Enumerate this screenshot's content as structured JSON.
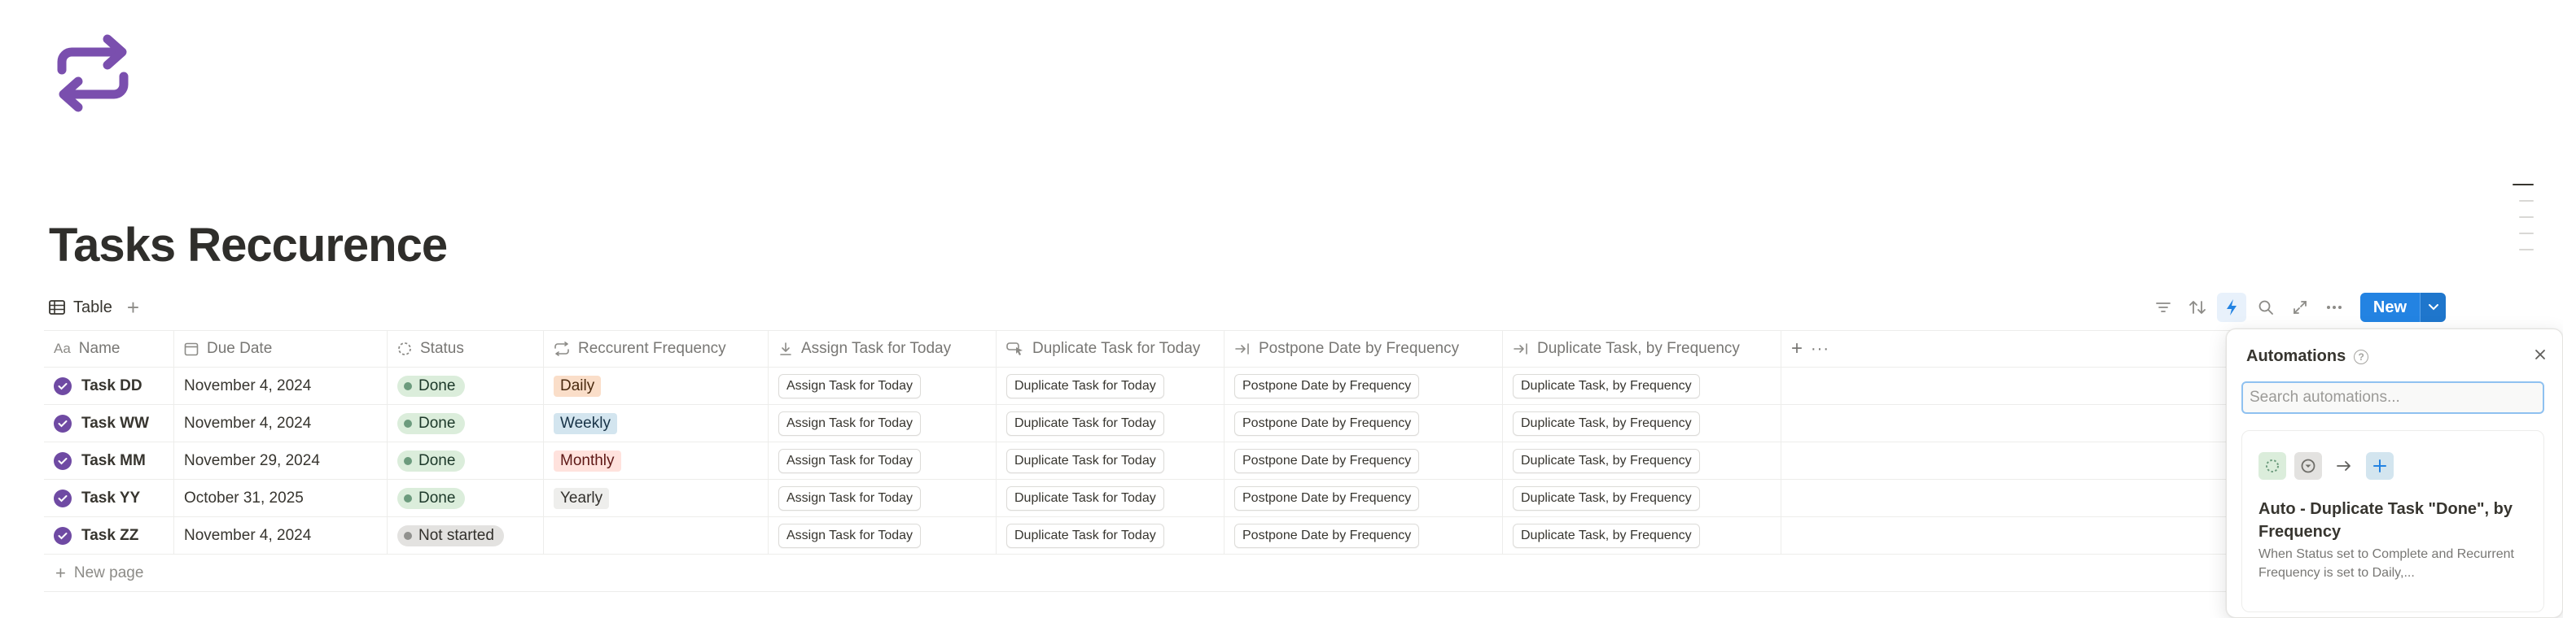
{
  "page": {
    "icon": "repeat-arrows-icon",
    "title": "Tasks Reccurence"
  },
  "view": {
    "tab_label": "Table",
    "add_view_icon": "plus-icon"
  },
  "toolbar": {
    "icons": [
      "filter-icon",
      "sort-icon",
      "lightning-icon",
      "search-icon",
      "expand-icon",
      "more-icon"
    ],
    "new_label": "New"
  },
  "columns": [
    {
      "label": "Name",
      "icon": "text-aa-icon"
    },
    {
      "label": "Due Date",
      "icon": "calendar-icon"
    },
    {
      "label": "Status",
      "icon": "status-dashed-icon"
    },
    {
      "label": "Reccurent Frequency",
      "icon": "repeat-icon"
    },
    {
      "label": "Assign Task for Today",
      "icon": "download-arrow-icon"
    },
    {
      "label": "Duplicate Task for Today",
      "icon": "button-cursor-icon"
    },
    {
      "label": "Postpone Date by Frequency",
      "icon": "arrow-bar-right-icon"
    },
    {
      "label": "Duplicate Task, by Frequency",
      "icon": "arrow-bar-right-icon"
    }
  ],
  "rows": [
    {
      "name": "Task DD",
      "due": "November 4, 2024",
      "status": "Done",
      "freq": "Daily",
      "assign": "Assign Task for Today",
      "duplicate": "Duplicate Task for Today",
      "postpone": "Postpone Date by Frequency",
      "dupfreq": "Duplicate Task, by Frequency"
    },
    {
      "name": "Task WW",
      "due": "November 4, 2024",
      "status": "Done",
      "freq": "Weekly",
      "assign": "Assign Task for Today",
      "duplicate": "Duplicate Task for Today",
      "postpone": "Postpone Date by Frequency",
      "dupfreq": "Duplicate Task, by Frequency"
    },
    {
      "name": "Task MM",
      "due": "November 29, 2024",
      "status": "Done",
      "freq": "Monthly",
      "assign": "Assign Task for Today",
      "duplicate": "Duplicate Task for Today",
      "postpone": "Postpone Date by Frequency",
      "dupfreq": "Duplicate Task, by Frequency"
    },
    {
      "name": "Task YY",
      "due": "October 31, 2025",
      "status": "Done",
      "freq": "Yearly",
      "assign": "Assign Task for Today",
      "duplicate": "Duplicate Task for Today",
      "postpone": "Postpone Date by Frequency",
      "dupfreq": "Duplicate Task, by Frequency"
    },
    {
      "name": "Task ZZ",
      "due": "November 4, 2024",
      "status": "Not started",
      "freq": "",
      "assign": "Assign Task for Today",
      "duplicate": "Duplicate Task for Today",
      "postpone": "Postpone Date by Frequency",
      "dupfreq": "Duplicate Task, by Frequency"
    }
  ],
  "new_page_label": "New page",
  "automations": {
    "title": "Automations",
    "search_placeholder": "Search automations...",
    "card": {
      "title": "Auto - Duplicate Task \"Done\", by Frequency",
      "description": "When Status set to Complete and Recurrent Frequency is set to Daily,..."
    }
  },
  "colors": {
    "accent": "#2383e2",
    "icon_purple": "#6f4aa3",
    "done_bg": "#dbeddb",
    "done_dot": "#6c9b7d",
    "not_started_bg": "#e3e2e0",
    "not_started_dot": "#91918e",
    "daily_bg": "#fadec9",
    "weekly_bg": "#d3e5ef",
    "monthly_bg": "#ffe2dd",
    "yearly_bg": "#eeeeec"
  }
}
